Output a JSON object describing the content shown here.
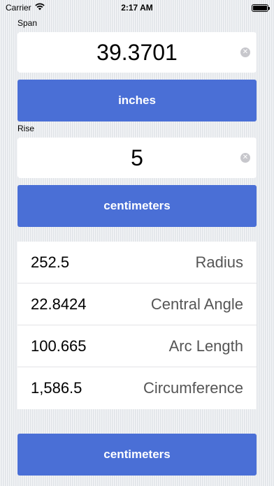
{
  "status_bar": {
    "carrier": "Carrier",
    "time": "2:17 AM"
  },
  "span": {
    "label": "Span",
    "value": "39.3701",
    "unit_button": "inches"
  },
  "rise": {
    "label": "Rise",
    "value": "5",
    "unit_button": "centimeters"
  },
  "results": [
    {
      "value": "252.5",
      "name": "Radius"
    },
    {
      "value": "22.8424",
      "name": "Central Angle"
    },
    {
      "value": "100.665",
      "name": "Arc Length"
    },
    {
      "value": "1,586.5",
      "name": "Circumference"
    }
  ],
  "output_unit_button": "centimeters",
  "colors": {
    "button": "#4a6fd6",
    "background": "#e9ecef"
  }
}
